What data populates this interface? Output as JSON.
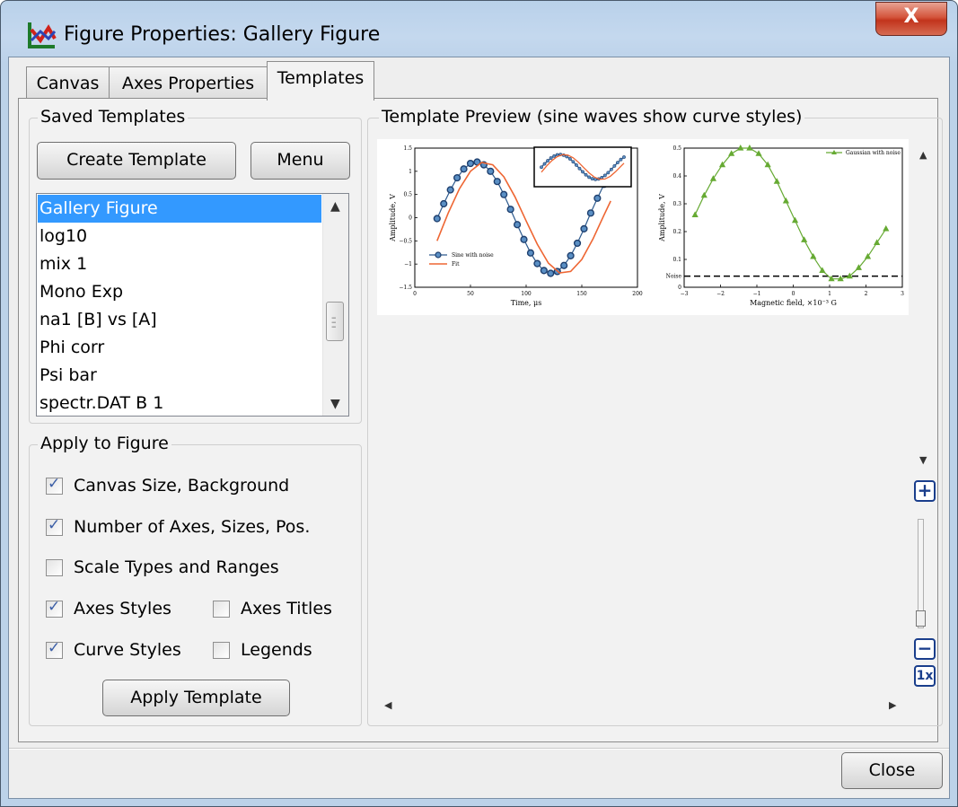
{
  "window": {
    "title": "Figure Properties: Gallery Figure",
    "close_glyph": "X"
  },
  "tabs": [
    {
      "label": "Canvas",
      "active": false
    },
    {
      "label": "Axes Properties",
      "active": false
    },
    {
      "label": "Templates",
      "active": true
    }
  ],
  "saved_templates": {
    "title": "Saved Templates",
    "create_label": "Create Template",
    "menu_label": "Menu",
    "items": [
      "Gallery Figure",
      "log10",
      "mix 1",
      "Mono Exp",
      "na1 [B] vs [A]",
      "Phi corr",
      "Psi bar",
      "spectr.DAT B 1"
    ],
    "selected": "Gallery Figure"
  },
  "apply": {
    "title": "Apply to Figure",
    "options": [
      {
        "label": "Canvas Size, Background",
        "checked": true
      },
      {
        "label": "Number of Axes, Sizes, Pos.",
        "checked": true
      },
      {
        "label": "Scale Types and Ranges",
        "checked": false
      },
      {
        "label": "Axes Styles",
        "checked": true
      },
      {
        "label": "Axes Titles",
        "checked": false
      },
      {
        "label": "Curve Styles",
        "checked": true
      },
      {
        "label": "Legends",
        "checked": false
      }
    ],
    "button_label": "Apply Template"
  },
  "preview": {
    "title": "Template Preview (sine waves show curve styles)",
    "zoom_in": "+",
    "zoom_out": "−",
    "zoom_reset": "1x"
  },
  "chart_data": [
    {
      "type": "line",
      "xlabel": "Time, μs",
      "ylabel": "Amplitude, V",
      "xlim": [
        0,
        200
      ],
      "ylim": [
        -1.5,
        1.5
      ],
      "x_ticks": [
        "0",
        "50",
        "100",
        "150",
        "200"
      ],
      "y_ticks": [
        "1.5",
        "1",
        "0.5",
        "0",
        "−0.5",
        "−1",
        "−1.5"
      ],
      "series": [
        {
          "name": "Sine with noise",
          "style": "markers-line",
          "color": "#2d5a8e",
          "x": [
            20,
            26,
            32,
            38,
            44,
            50,
            56,
            62,
            68,
            74,
            80,
            86,
            92,
            98,
            104,
            110,
            116,
            122,
            128,
            134,
            140,
            146,
            152,
            158,
            164,
            170,
            176
          ],
          "y": [
            -0.02,
            0.3,
            0.6,
            0.86,
            1.05,
            1.17,
            1.2,
            1.14,
            1.0,
            0.78,
            0.5,
            0.18,
            -0.15,
            -0.47,
            -0.76,
            -0.99,
            -1.14,
            -1.2,
            -1.16,
            -1.03,
            -0.82,
            -0.55,
            -0.24,
            0.1,
            0.42,
            0.72,
            0.95
          ]
        },
        {
          "name": "Fit",
          "style": "line",
          "color": "#ee6633",
          "x": [
            20,
            30,
            40,
            50,
            60,
            70,
            80,
            90,
            100,
            110,
            120,
            130,
            140,
            150,
            160,
            170,
            176
          ],
          "y": [
            -0.5,
            0.1,
            0.62,
            1.0,
            1.19,
            1.14,
            0.88,
            0.45,
            -0.07,
            -0.57,
            -0.98,
            -1.19,
            -1.16,
            -0.9,
            -0.46,
            0.06,
            0.36
          ]
        }
      ],
      "legend_position": "bottom-left",
      "inset": true
    },
    {
      "type": "line",
      "xlabel": "Magnetic field, ×10⁻³ G",
      "ylabel": "Amplitude, V",
      "xlim": [
        -3,
        3
      ],
      "ylim": [
        0,
        0.5
      ],
      "x_ticks": [
        "−3",
        "−2",
        "−1",
        "0",
        "1",
        "2",
        "3"
      ],
      "y_ticks": [
        "0.5",
        "0.4",
        "0.3",
        "0.2",
        "0.1",
        "0"
      ],
      "series": [
        {
          "name": "Gaussian with noise",
          "style": "triangles-line",
          "color": "#66aa33",
          "x": [
            -2.7,
            -2.45,
            -2.2,
            -1.95,
            -1.7,
            -1.45,
            -1.2,
            -0.95,
            -0.7,
            -0.45,
            -0.2,
            0.05,
            0.3,
            0.55,
            0.8,
            1.05,
            1.3,
            1.55,
            1.8,
            2.05,
            2.3,
            2.55
          ],
          "y": [
            0.26,
            0.33,
            0.39,
            0.44,
            0.48,
            0.5,
            0.5,
            0.48,
            0.44,
            0.38,
            0.31,
            0.24,
            0.17,
            0.11,
            0.06,
            0.03,
            0.03,
            0.04,
            0.07,
            0.11,
            0.16,
            0.21
          ]
        }
      ],
      "reference_line": {
        "label": "Noise",
        "y": 0.04,
        "style": "dashed"
      },
      "legend_position": "top-right"
    }
  ]
}
